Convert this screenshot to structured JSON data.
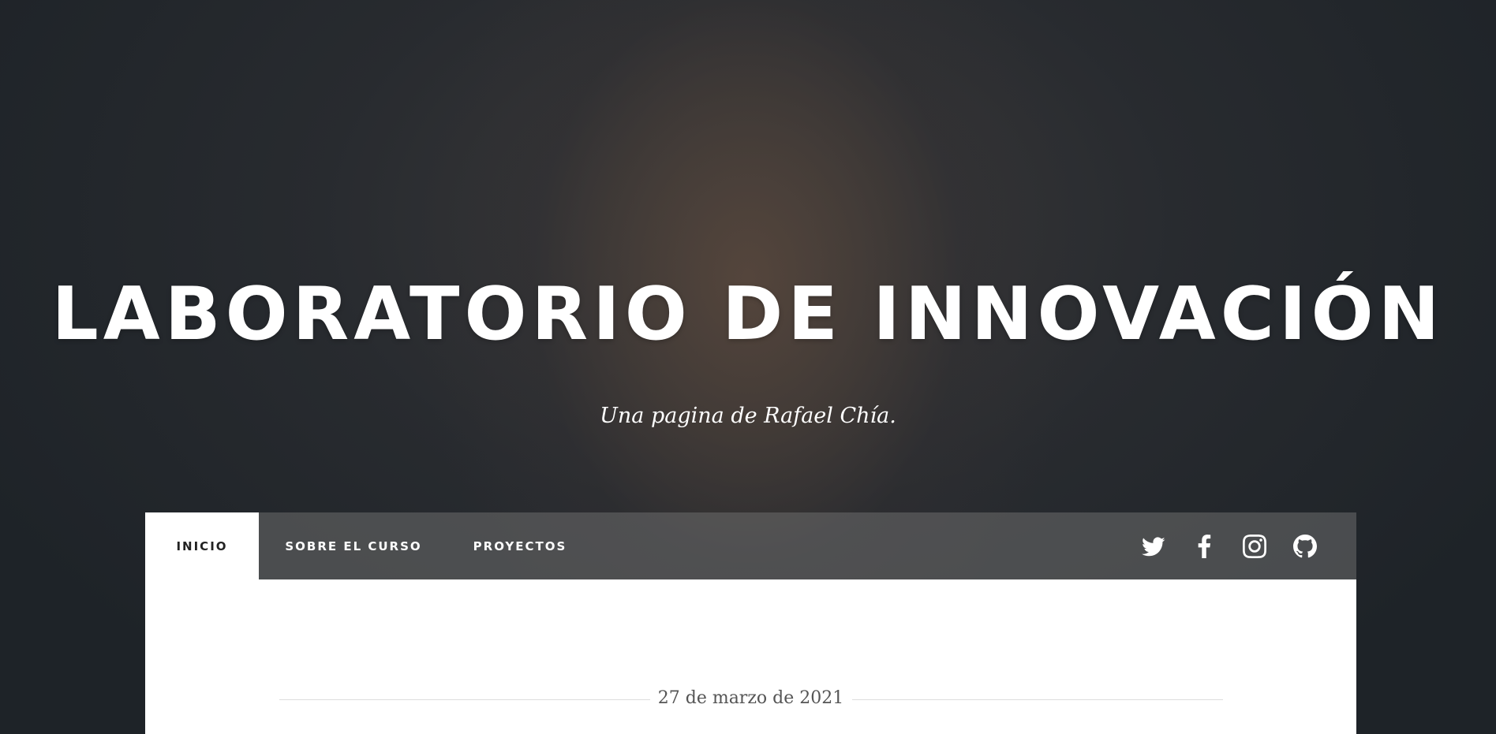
{
  "site": {
    "title": "LABORATORIO DE INNOVACIÓN",
    "subtitle": "Una pagina de Rafael Chía."
  },
  "nav": {
    "items": [
      {
        "label": "INICIO",
        "active": true
      },
      {
        "label": "SOBRE EL CURSO",
        "active": false
      },
      {
        "label": "PROYECTOS",
        "active": false
      }
    ],
    "social": [
      {
        "icon": "twitter-icon"
      },
      {
        "icon": "facebook-icon"
      },
      {
        "icon": "instagram-icon"
      },
      {
        "icon": "github-icon"
      }
    ]
  },
  "post": {
    "date": "27 de marzo de 2021"
  },
  "colors": {
    "background": "#1e2328",
    "text": "#ffffff",
    "active_tab_bg": "#ffffff",
    "active_tab_text": "#222222"
  }
}
